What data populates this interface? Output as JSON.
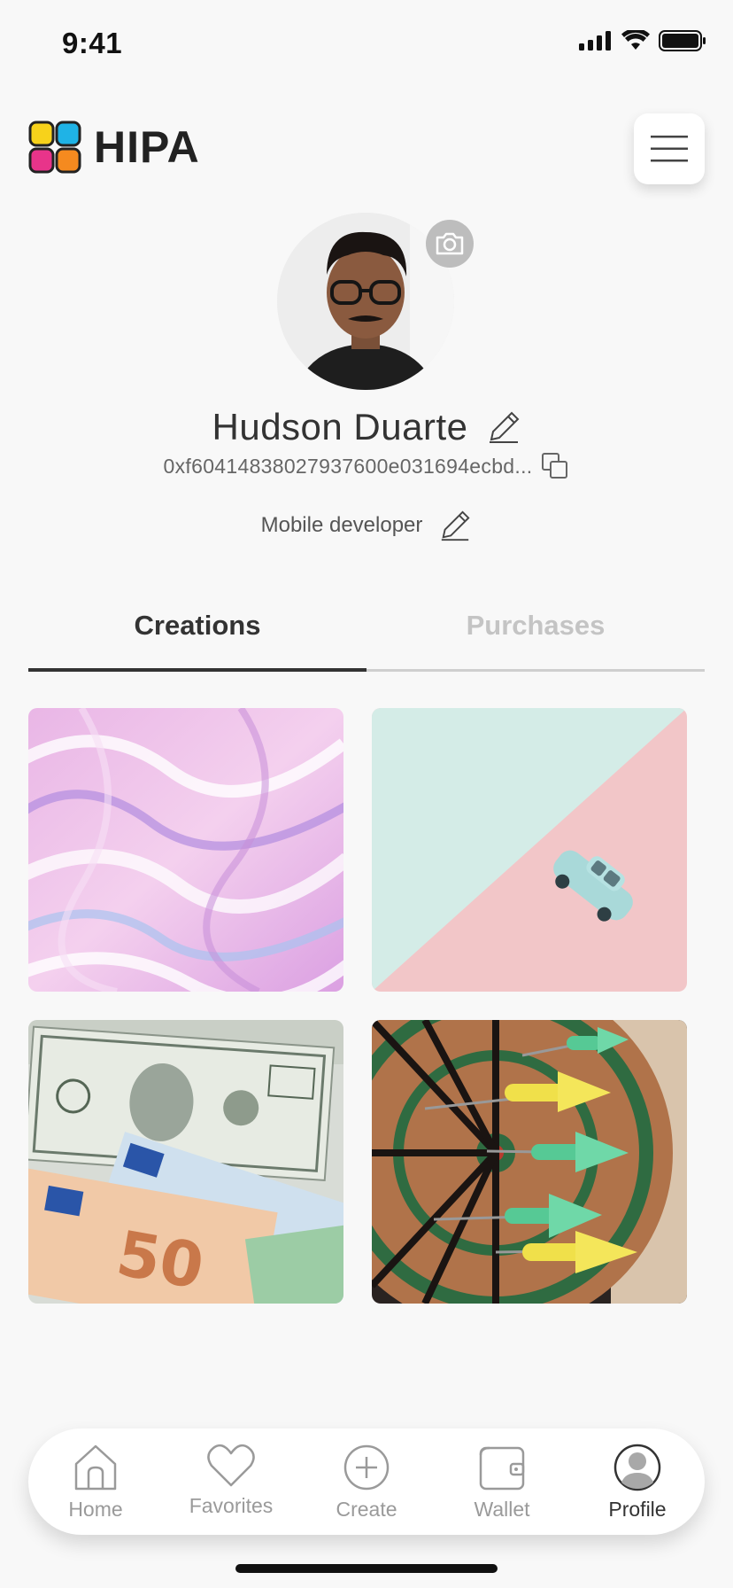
{
  "status_bar": {
    "time": "9:41"
  },
  "header": {
    "logo_text": "HIPA"
  },
  "profile": {
    "name": "Hudson Duarte",
    "wallet_address": "0xf60414838027937600e031694ecbd...",
    "bio": "Mobile developer"
  },
  "tabs": [
    {
      "label": "Creations",
      "active": true
    },
    {
      "label": "Purchases",
      "active": false
    }
  ],
  "gallery": [
    {
      "name": "pastel-swirl-image"
    },
    {
      "name": "toy-car-image"
    },
    {
      "name": "money-bills-image"
    },
    {
      "name": "darts-board-image"
    }
  ],
  "nav": [
    {
      "label": "Home",
      "icon": "home-icon"
    },
    {
      "label": "Favorites",
      "icon": "heart-icon"
    },
    {
      "label": "Create",
      "icon": "plus-circle-icon"
    },
    {
      "label": "Wallet",
      "icon": "wallet-icon"
    },
    {
      "label": "Profile",
      "icon": "profile-icon",
      "active": true
    }
  ],
  "colors": {
    "background": "#f8f8f8",
    "text": "#333333",
    "inactive": "#c4c4c4",
    "accent_logo": [
      "#f7d21b",
      "#1fb3e6",
      "#e8348a",
      "#f58a1f"
    ]
  }
}
